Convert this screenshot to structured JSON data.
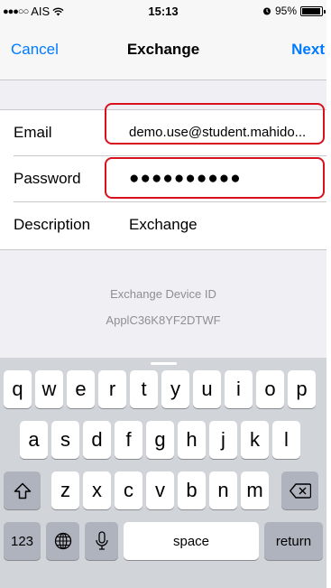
{
  "status_bar": {
    "carrier": "AIS",
    "time": "15:13",
    "battery_text": "95%",
    "battery_level": 0.95,
    "signal_dots_filled": 3,
    "signal_dots_total": 5
  },
  "nav": {
    "cancel_label": "Cancel",
    "title": "Exchange",
    "next_label": "Next"
  },
  "form": {
    "email": {
      "label": "Email",
      "value": "demo.use@student.mahido..."
    },
    "password": {
      "label": "Password",
      "value": "●●●●●●●●●●"
    },
    "description": {
      "label": "Description",
      "value": "Exchange"
    }
  },
  "device": {
    "label": "Exchange Device ID",
    "id": "ApplC36K8YF2DTWF"
  },
  "keyboard": {
    "row1": [
      "q",
      "w",
      "e",
      "r",
      "t",
      "y",
      "u",
      "i",
      "o",
      "p"
    ],
    "row2": [
      "a",
      "s",
      "d",
      "f",
      "g",
      "h",
      "j",
      "k",
      "l"
    ],
    "row3": [
      "z",
      "x",
      "c",
      "v",
      "b",
      "n",
      "m"
    ],
    "numbers_label": "123",
    "space_label": "space",
    "return_label": "return"
  },
  "colors": {
    "accent": "#007aff",
    "highlight_border": "#d9101e",
    "keyboard_bg": "#d1d4d9"
  }
}
